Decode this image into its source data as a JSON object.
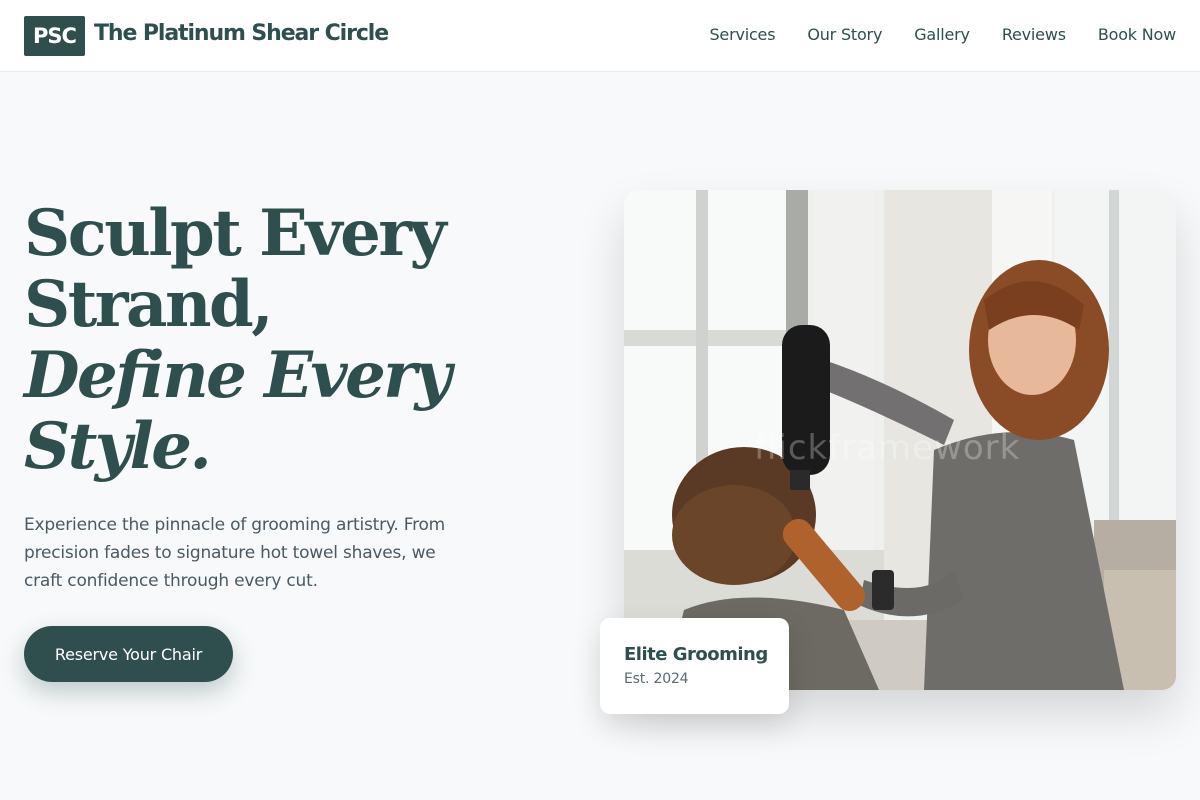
{
  "header": {
    "logo_text": "PSC",
    "brand_name": "The Platinum Shear Circle",
    "nav": [
      "Services",
      "Our Story",
      "Gallery",
      "Reviews",
      "Book Now"
    ]
  },
  "hero": {
    "headline_line1": "Sculpt Every",
    "headline_line2": "Strand,",
    "headline_line3": "Define Every",
    "headline_line4": "Style.",
    "description": "Experience the pinnacle of grooming artistry. From precision fades to signature hot towel shaves, we craft confidence through every cut.",
    "cta_label": "Reserve Your Chair",
    "image_watermark": "flickframework"
  },
  "badge": {
    "title": "Elite Grooming",
    "subtitle": "Est. 2024"
  },
  "colors": {
    "brand": "#2f4f4f",
    "background": "#f7f9fa",
    "body_text": "#4a5a63"
  }
}
